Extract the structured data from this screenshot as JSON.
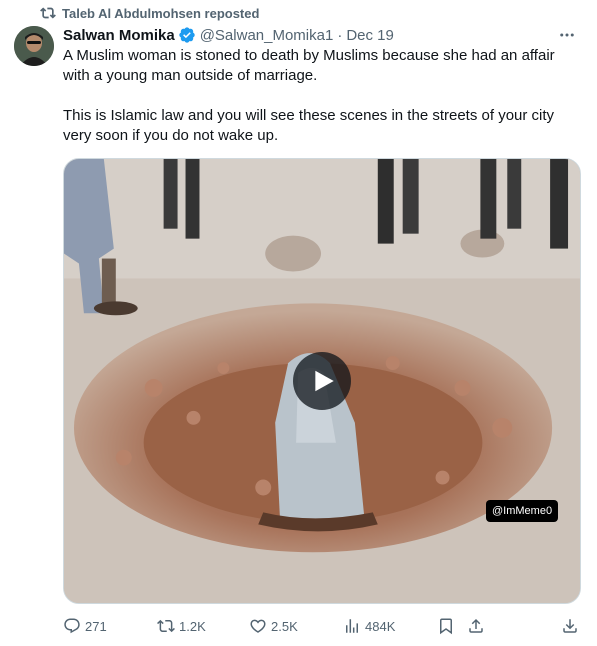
{
  "repost": {
    "label": "Taleb Al Abdulmohsen reposted"
  },
  "tweet": {
    "author_name": "Salwan Momika",
    "handle": "@Salwan_Momika1",
    "separator": "·",
    "date": "Dec 19",
    "text_line1": "A Muslim woman is stoned to death by Muslims because she had an affair with a young man outside of marriage.",
    "text_line2": "This is Islamic law and you will see these scenes in the streets of your city very soon if you do not wake up."
  },
  "media": {
    "watermark": "@ImMeme0",
    "play_icon": "play-icon"
  },
  "actions": {
    "replies": "271",
    "reposts": "1.2K",
    "likes": "2.5K",
    "views": "484K"
  },
  "colors": {
    "text_primary": "#0f1419",
    "text_secondary": "#536471",
    "verified": "#1d9bf0"
  }
}
